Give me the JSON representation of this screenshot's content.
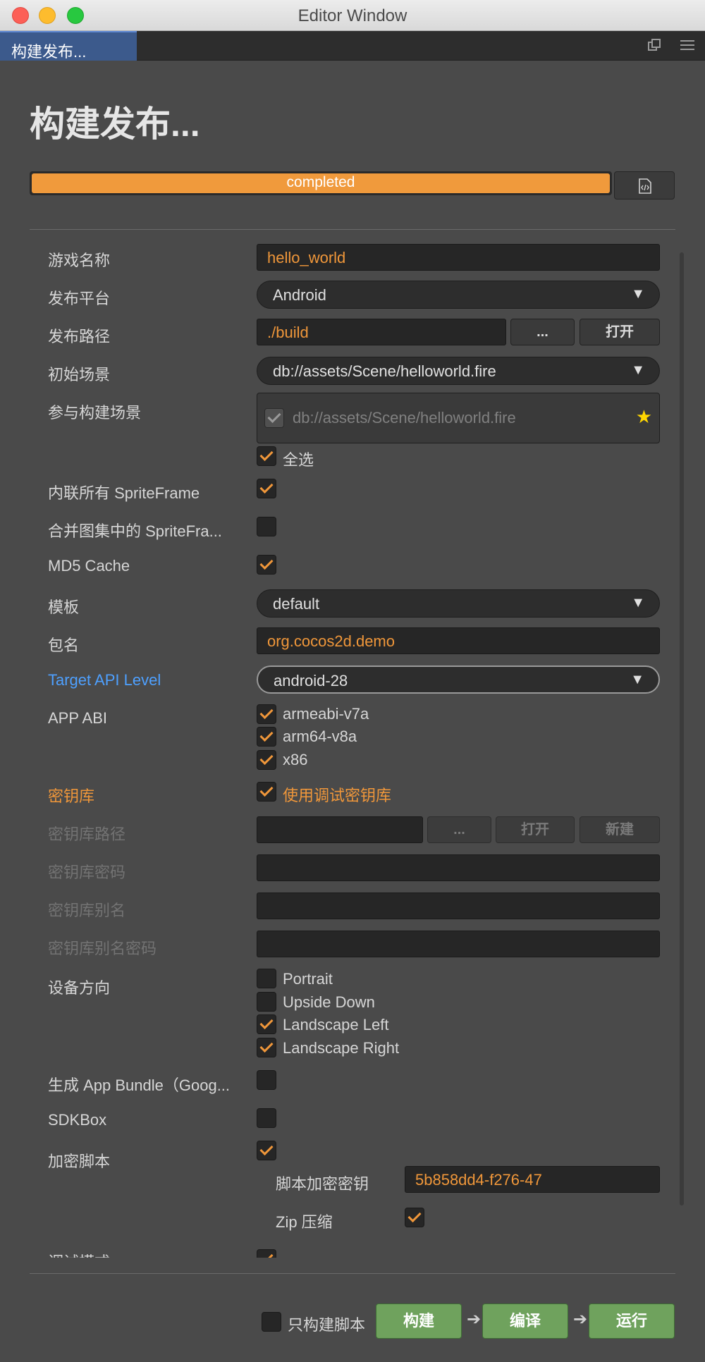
{
  "window": {
    "title": "Editor Window"
  },
  "tab": {
    "label": "构建发布..."
  },
  "page": {
    "title": "构建发布..."
  },
  "progress": {
    "text": "completed",
    "fraction": 1.0
  },
  "form": {
    "game_name": {
      "label": "游戏名称",
      "value": "hello_world"
    },
    "platform": {
      "label": "发布平台",
      "value": "Android"
    },
    "build_path": {
      "label": "发布路径",
      "value": "./build",
      "browse": "...",
      "open": "打开"
    },
    "start_scene": {
      "label": "初始场景",
      "value": "db://assets/Scene/helloworld.fire"
    },
    "build_scenes": {
      "label": "参与构建场景",
      "scene": "db://assets/Scene/helloworld.fire",
      "select_all": "全选"
    },
    "inline_spriteframe": {
      "label": "内联所有 SpriteFrame",
      "checked": true
    },
    "merge_spriteframe": {
      "label": "合并图集中的 SpriteFra...",
      "checked": false
    },
    "md5_cache": {
      "label": "MD5 Cache",
      "checked": true
    },
    "template": {
      "label": "模板",
      "value": "default"
    },
    "package_name": {
      "label": "包名",
      "value": "org.cocos2d.demo"
    },
    "target_api": {
      "label": "Target API Level",
      "value": "android-28"
    },
    "app_abi": {
      "label": "APP ABI",
      "options": [
        "armeabi-v7a",
        "arm64-v8a",
        "x86"
      ]
    },
    "keystore": {
      "label": "密钥库",
      "debug_label": "使用调试密钥库"
    },
    "keystore_path": {
      "label": "密钥库路径",
      "browse": "...",
      "open": "打开",
      "new": "新建"
    },
    "keystore_password": {
      "label": "密钥库密码"
    },
    "keystore_alias": {
      "label": "密钥库别名"
    },
    "keystore_alias_password": {
      "label": "密钥库别名密码"
    },
    "orientation": {
      "label": "设备方向",
      "portrait": "Portrait",
      "upside_down": "Upside Down",
      "landscape_left": "Landscape Left",
      "landscape_right": "Landscape Right"
    },
    "app_bundle": {
      "label": "生成 App Bundle（Goog...",
      "checked": false
    },
    "sdkbox": {
      "label": "SDKBox",
      "checked": false
    },
    "encrypt_js": {
      "label": "加密脚本",
      "checked": true
    },
    "encrypt_key": {
      "label": "脚本加密密钥",
      "value": "5b858dd4-f276-47"
    },
    "zip": {
      "label": "Zip 压缩",
      "checked": true
    },
    "debug_mode": {
      "label": "调试模式"
    }
  },
  "footer": {
    "only_script": "只构建脚本",
    "build": "构建",
    "compile": "编译",
    "run": "运行"
  },
  "colors": {
    "accent": "#f0973a",
    "link": "#4ea0ff",
    "action": "#6fa25d",
    "tab": "#3c5a8c"
  }
}
